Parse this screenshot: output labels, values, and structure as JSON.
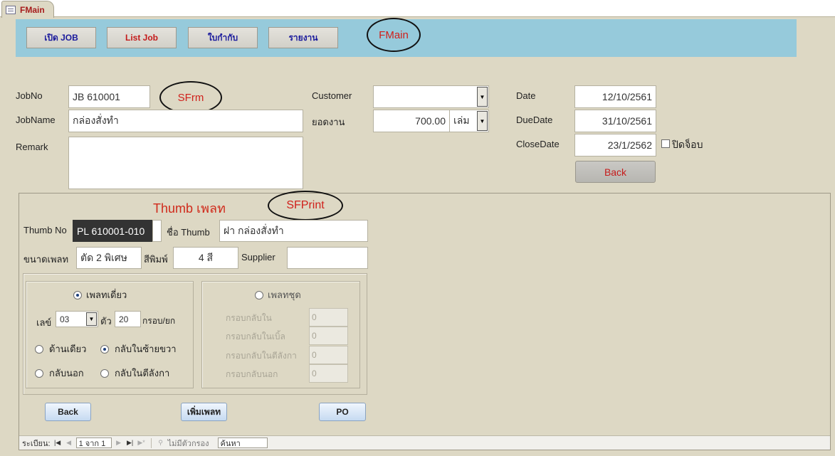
{
  "tab": {
    "label": "FMain"
  },
  "nav": {
    "buttons": [
      "เปิด JOB",
      "List Job",
      "ใบกำกับ",
      "รายงาน"
    ],
    "button_colors": [
      "#1a1a9c",
      "#c41a1a",
      "#1a1a9c",
      "#1a1a9c"
    ],
    "annotation": "FMain"
  },
  "form": {
    "jobno_label": "JobNo",
    "jobno_value": "JB 610001",
    "jobname_label": "JobName",
    "jobname_value": "กล่องสั่งทำ",
    "remark_label": "Remark",
    "remark_value": "",
    "annotation": "SFrm",
    "customer_label": "Customer",
    "customer_value": "",
    "amount_label": "ยอดงาน",
    "amount_value": "700.00",
    "unit_value": "เล่ม",
    "date_label": "Date",
    "date_value": "12/10/2561",
    "duedate_label": "DueDate",
    "duedate_value": "31/10/2561",
    "closedate_label": "CloseDate",
    "closedate_value": "23/1/2562",
    "closejob_label": "ปิดจ็อบ",
    "back_label": "Back"
  },
  "subform": {
    "title": "Thumb เพลท",
    "annotation": "SFPrint",
    "thumbno_label": "Thumb No",
    "thumbno_value": "PL 610001-010",
    "thumbname_label": "ชื่อ Thumb",
    "thumbname_value": "ฝา กล่องสั่งทำ",
    "platesize_label": "ขนาดเพลท",
    "platesize_value": "ตัด 2 พิเศษ",
    "printcolor_label": "สีพิมพ์",
    "printcolor_value": "4 สี",
    "supplier_label": "Supplier",
    "supplier_value": "",
    "single": {
      "radio_label": "เพลทเดี่ยว",
      "number_label": "เลข์",
      "number_value": "03",
      "count_label": "ตัว",
      "count_value": "20",
      "per_label": "กรอบ/ยก",
      "opt1": "ด้านเดียว",
      "opt2": "กลับในซ้ายขวา",
      "opt3": "กลับนอก",
      "opt4": "กลับในตีลังกา"
    },
    "set": {
      "radio_label": "เพลทชุด",
      "rows": [
        {
          "label": "กรอบกลับใน",
          "value": "0"
        },
        {
          "label": "กรอบกลับในเบิ้ล",
          "value": "0"
        },
        {
          "label": "กรอบกลับในตีลังกา",
          "value": "0"
        },
        {
          "label": "กรอบกลับนอก",
          "value": "0"
        }
      ]
    },
    "back_label": "Back",
    "add_label": "เพิ่มเพลท",
    "po_label": "PO"
  },
  "record_nav": {
    "label": "ระเบียน:",
    "position": "1 จาก 1",
    "filter": "ไม่มีตัวกรอง",
    "search_label": "ค้นหา"
  }
}
